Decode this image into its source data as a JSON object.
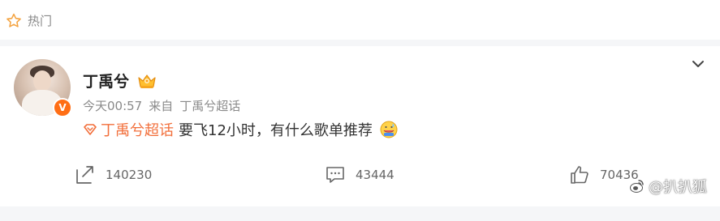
{
  "section": {
    "icon": "star-outline-icon",
    "label": "热门"
  },
  "post": {
    "username": "丁禹兮",
    "badge_icon": "crown-badge-icon",
    "verified_mark": "V",
    "time": "今天00:57",
    "source_prefix": "来自",
    "source": "丁禹兮超话",
    "topic_icon": "supertopic-diamond-icon",
    "topic": "丁禹兮超话",
    "text": "要飞12小时，有什么歌单推荐",
    "emoji_icon": "sweat-smile-emoji-icon"
  },
  "actions": {
    "forward": {
      "icon": "share-icon",
      "count": "140230"
    },
    "comment": {
      "icon": "comment-icon",
      "count": "43444"
    },
    "like": {
      "icon": "thumbs-up-icon",
      "count": "70436"
    }
  },
  "watermark": {
    "icon": "weibo-logo-icon",
    "text": "@扒扒狐"
  },
  "colors": {
    "accent_orange": "#ff6e15",
    "topic_orange": "#f26f3b",
    "meta_gray": "#8a8a8a"
  }
}
